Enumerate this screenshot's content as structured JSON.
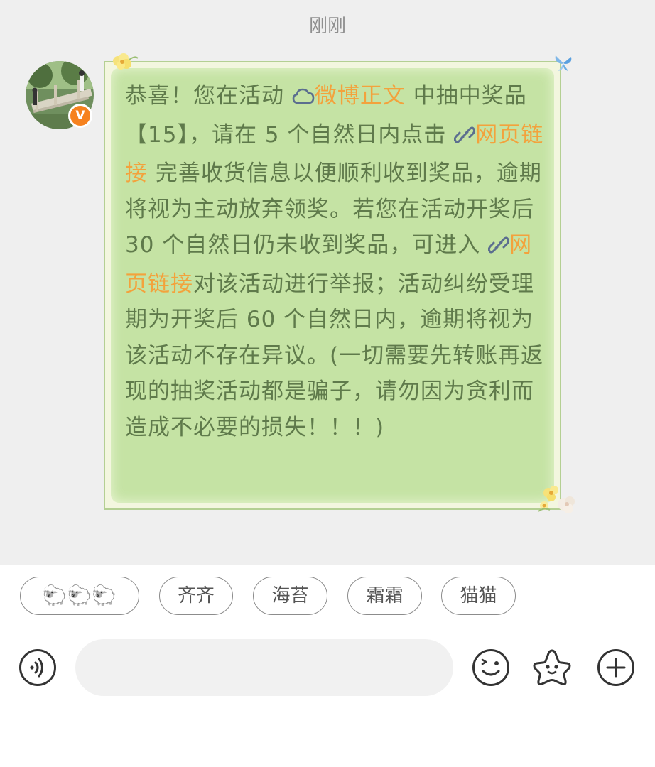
{
  "timestamp": "刚刚",
  "message": {
    "segments": [
      {
        "text": "恭喜！您在活动 ",
        "link": false
      },
      {
        "text": "微博正文",
        "link": true,
        "icon": "weibo-cloud-icon"
      },
      {
        "text": " 中抽中奖品【15】，请在 5 个自然日内点击 ",
        "link": false
      },
      {
        "text": "网页链接",
        "link": true,
        "icon": "link-icon"
      },
      {
        "text": " 完善收货信息以便顺利收到奖品，逾期将视为主动放弃领奖。若您在活动开奖后 30 个自然日仍未收到奖品，可进入 ",
        "link": false
      },
      {
        "text": "网页链接",
        "link": true,
        "icon": "link-icon"
      },
      {
        "text": "对该活动进行举报；活动纠纷受理期为开奖后 60 个自然日内，逾期将视为该活动不存在异议。(一切需要先转账再返现的抽奖活动都是骗子，请勿因为贪利而造成不必要的损失！！！)",
        "link": false
      }
    ]
  },
  "avatar": {
    "badge": "V",
    "badge_color": "#f6821f"
  },
  "quick_replies": [
    "🐑🐑🐑",
    "齐齐",
    "海苔",
    "霜霜",
    "猫猫"
  ],
  "input": {
    "placeholder": ""
  },
  "icons": {
    "voice": "voice-icon",
    "emoji": "emoji-icon",
    "sticker": "star-sticker-icon",
    "add": "add-icon"
  },
  "colors": {
    "bubble_bg": "#c5e3a4",
    "bubble_text": "#5f7a4b",
    "link": "#f3a23c",
    "chat_bg": "#efefef"
  }
}
